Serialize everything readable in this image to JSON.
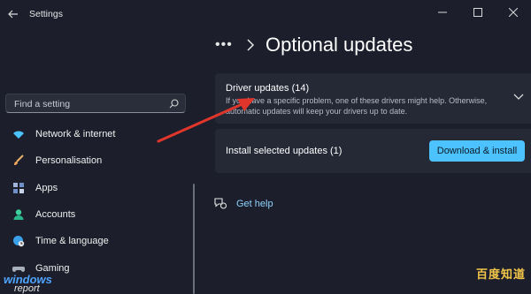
{
  "window": {
    "title": "Settings"
  },
  "search": {
    "placeholder": "Find a setting"
  },
  "sidebar": {
    "items": [
      {
        "label": "Network & internet",
        "icon": "wifi-icon"
      },
      {
        "label": "Personalisation",
        "icon": "brush-icon"
      },
      {
        "label": "Apps",
        "icon": "apps-icon"
      },
      {
        "label": "Accounts",
        "icon": "person-icon"
      },
      {
        "label": "Time & language",
        "icon": "globe-clock-icon"
      },
      {
        "label": "Gaming",
        "icon": "gamepad-icon"
      }
    ]
  },
  "header": {
    "dots": "•••",
    "title": "Optional updates"
  },
  "driver_card": {
    "title": "Driver updates (14)",
    "description": "If you have a specific problem, one of these drivers might help. Otherwise, automatic updates will keep your drivers up to date."
  },
  "install_card": {
    "label": "Install selected updates (1)",
    "button": "Download & install"
  },
  "help": {
    "label": "Get help"
  },
  "watermark": {
    "left_top": "windows",
    "left_bottom": "report",
    "right": "百度知道"
  },
  "colors": {
    "accent": "#4cc2ff",
    "background": "#1c1f2b",
    "card": "#252936",
    "arrow": "#e0352b"
  }
}
